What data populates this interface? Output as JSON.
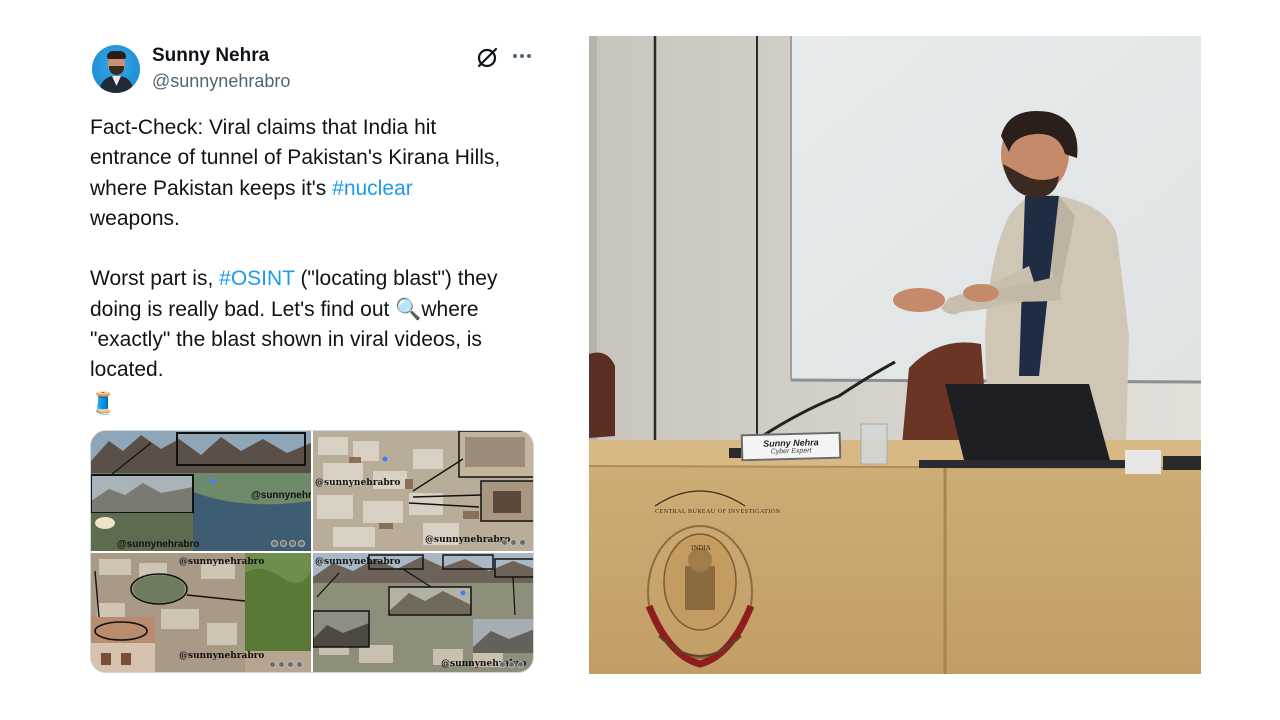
{
  "tweet": {
    "author_name": "Sunny Nehra",
    "author_handle": "@sunnynehrabro",
    "grok_icon": "grok-icon",
    "more_icon": "more-options-icon",
    "lines": {
      "l1": "Fact-Check: Viral claims that India hit",
      "l2": "entrance of tunnel of Pakistan's Kirana Hills,",
      "l3_pre": "where Pakistan keeps it's ",
      "l3_tag": "#nuclear",
      "l4": "weapons.",
      "l5_pre": "Worst part is, ",
      "l5_tag": "#OSINT",
      "l5_post": " (\"locating blast\") they",
      "l6_pre": "doing is really bad. Let's find out ",
      "l6_emoji": "🔍",
      "l6_post": "where",
      "l7": "\"exactly\" the blast shown in viral videos, is",
      "l8": "located.",
      "l9_emoji": "🧵"
    },
    "media": {
      "tile1_watermark_a": "@sunnynehra",
      "tile1_watermark_b": "@sunnynehrabro",
      "tile2_watermark_a": "@sunnynehrabro",
      "tile2_watermark_b": "@sunnynehrabro",
      "tile3_watermark_a": "@sunnynehrabro",
      "tile3_watermark_b": "@sunnynehrabro",
      "tile4_watermark_a": "@sunnynehrabro",
      "tile4_watermark_b": "@sunnynehrabro"
    }
  },
  "photo": {
    "nameplate_name": "Sunny Nehra",
    "nameplate_role": "Cyber Expert",
    "emblem_text_top": "CENTRAL BUREAU OF INVESTIGATION",
    "emblem_text_small": "INDIA",
    "colors": {
      "wall": "#d8d4cb",
      "desk": "#c9a46c",
      "blazer": "#cfc6b6"
    }
  },
  "colors": {
    "hashtag": "#1d9bf0",
    "name": "#0f1419",
    "handle": "#536471"
  }
}
